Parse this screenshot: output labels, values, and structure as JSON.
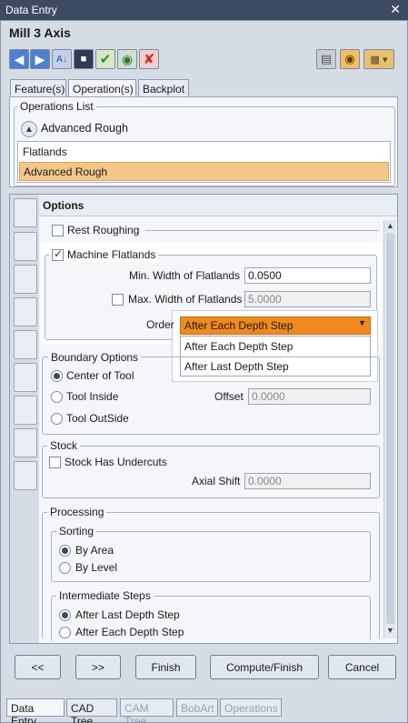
{
  "window": {
    "title": "Data Entry",
    "close_glyph": "✕"
  },
  "header": {
    "title": "Mill 3 Axis"
  },
  "toolbar": {
    "icons": [
      "back-arrow-icon",
      "forward-arrow-icon",
      "tool-library-icon",
      "save-icon",
      "check-icon",
      "globe-icon",
      "delete-icon",
      "layers-icon",
      "eye-icon",
      "settings-icon"
    ]
  },
  "tabs": {
    "feature": "Feature(s)",
    "operation": "Operation(s)",
    "backplot": "Backplot"
  },
  "operations": {
    "legend": "Operations List",
    "current": "Advanced Rough",
    "items": [
      "Flatlands",
      "Advanced Rough"
    ],
    "selected_index": 1
  },
  "options": {
    "header": "Options",
    "rest_roughing": {
      "label": "Rest Roughing",
      "checked": false
    },
    "machine_flatlands": {
      "label": "Machine Flatlands",
      "checked": true
    },
    "min_width": {
      "label": "Min. Width of Flatlands",
      "value": "0.0500"
    },
    "max_width": {
      "label": "Max. Width of Flatlands",
      "value": "5.0000",
      "checked": false
    },
    "order": {
      "label": "Order",
      "selected": "After Each Depth Step",
      "options": [
        "After Each Depth Step",
        "After Last Depth Step"
      ]
    },
    "boundary": {
      "legend": "Boundary Options",
      "center": "Center of Tool",
      "inside": "Tool Inside",
      "outside": "Tool OutSide",
      "offset_label": "Offset",
      "offset_value": "0.0000"
    },
    "stock": {
      "legend": "Stock",
      "undercuts": "Stock Has Undercuts",
      "axial_label": "Axial Shift",
      "axial_value": "0.0000"
    },
    "processing": {
      "legend": "Processing",
      "sorting_legend": "Sorting",
      "by_area": "By Area",
      "by_level": "By Level",
      "steps_legend": "Intermediate Steps",
      "after_last": "After Last Depth Step",
      "after_each": "After Each Depth Step"
    }
  },
  "buttons": {
    "prev": "<<",
    "next": ">>",
    "finish": "Finish",
    "compute": "Compute/Finish",
    "cancel": "Cancel"
  },
  "bottom_tabs": {
    "data_entry": "Data Entry",
    "cad_tree": "CAD Tree",
    "cam_tree": "CAM Tree",
    "bobart": "BobArt",
    "operations": "Operations"
  },
  "colors": {
    "accent": "#f08a1f",
    "title_bar": "#3d4b62",
    "selection": "#f3c78a"
  }
}
